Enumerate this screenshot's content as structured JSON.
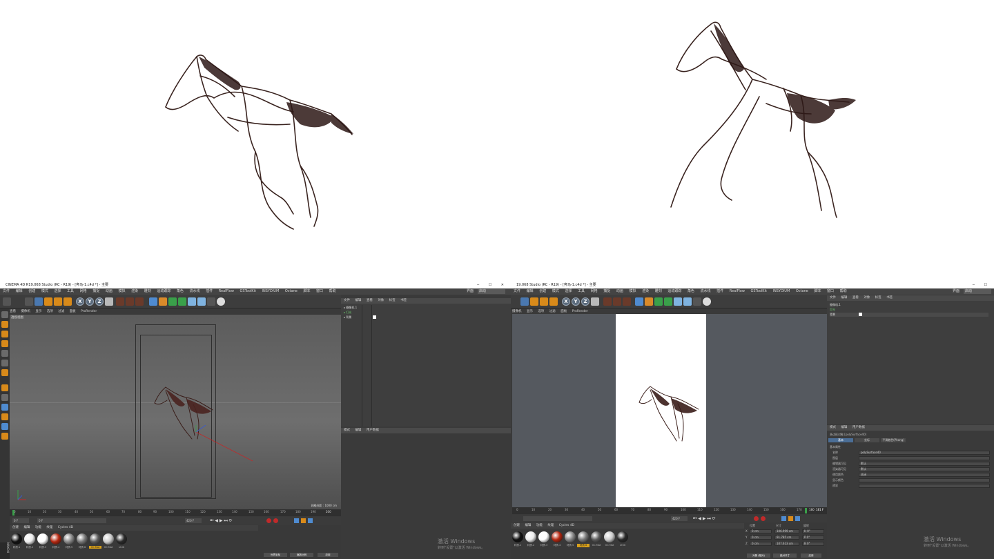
{
  "top_preview": {
    "left_horse": "horse-line-render",
    "right_horse": "horse-line-render"
  },
  "left_window": {
    "title": "CINEMA 4D R19.068 Studio (RC - R19) - [奔马-1.c4d *] - 主要",
    "menu": [
      "文件",
      "编辑",
      "创建",
      "模式",
      "选择",
      "工具",
      "网格",
      "捕捉",
      "动画",
      "模拟",
      "渲染",
      "雕刻",
      "运动跟踪",
      "运动图形",
      "角色",
      "流水线",
      "插件",
      "RealFlow",
      "X-Particles",
      "Octane",
      "脚本",
      "窗口",
      "帮助"
    ],
    "menu_short": [
      "文件",
      "编辑",
      "创建",
      "模式",
      "选择",
      "工具",
      "网格",
      "捕捉",
      "动画",
      "模拟",
      "渲染",
      "雕刻",
      "运动跟踪",
      "角色",
      "流水线",
      "插件",
      "RealFlow",
      "GSToolKit",
      "INSYDIUM",
      "Octane",
      "脚本",
      "窗口",
      "帮助"
    ],
    "layout_label": "界面",
    "layout_value": "启动",
    "viewport_menu": [
      "查看",
      "摄像机",
      "显示",
      "选项",
      "过滤",
      "面板",
      "ProRender"
    ],
    "viewport_label": "透视视图",
    "grid_label": "网格间距 : 1000 cm",
    "objects_menu": [
      "文件",
      "编辑",
      "查看",
      "对象",
      "标签",
      "书签"
    ],
    "objects": [
      {
        "name": "摄像机.1",
        "icon": "camera-icon"
      },
      {
        "name": "灯光",
        "icon": "light-icon"
      },
      {
        "name": "背景",
        "icon": "background-icon"
      }
    ],
    "attr_menu": [
      "模式",
      "编辑",
      "用户数据"
    ],
    "timeline_ticks": [
      "0",
      "10",
      "20",
      "30",
      "40",
      "50",
      "60",
      "70",
      "80",
      "90",
      "100",
      "110",
      "120",
      "130",
      "140",
      "150",
      "160",
      "170",
      "180",
      "190",
      "200"
    ],
    "frame_start": "0 F",
    "frame_current": "0 F",
    "frame_end": "420 F",
    "frame_end2": "420 F",
    "material_menu": [
      "创建",
      "编辑",
      "功能",
      "纹理",
      "Cycles 4D"
    ],
    "materials": [
      {
        "label": "材质.1",
        "color": "#111111"
      },
      {
        "label": "材质.2",
        "color": "#eeeeee"
      },
      {
        "label": "材质.3",
        "color": "#ffffff"
      },
      {
        "label": "材质.4",
        "color": "#b4260f"
      },
      {
        "label": "材质.5",
        "color": "#888888"
      },
      {
        "label": "材质.6",
        "color": "#777777"
      },
      {
        "label": "OC Mat",
        "color": "#5a5a5a"
      },
      {
        "label": "OC Mat",
        "color": "#cccccc"
      },
      {
        "label": "Unlit",
        "color": "#2a2a2a"
      }
    ],
    "coord_buttons": [
      "世界坐标",
      "缩放比例",
      "应用"
    ],
    "watermark_title": "激活 Windows",
    "watermark_sub": "转到\"设置\"以激活 Windows。"
  },
  "right_window": {
    "title": "19.068 Studio (RC - R19) - [奔马-1.c4d *] - 主要",
    "viewport_menu": [
      "摄像机",
      "显示",
      "选项",
      "过滤",
      "面板",
      "ProRender"
    ],
    "objects_menu": [
      "文件",
      "编辑",
      "查看",
      "对象",
      "标签",
      "书签"
    ],
    "objects": [
      {
        "name": "摄像机.1",
        "icon": "camera-icon"
      },
      {
        "name": "灯光",
        "icon": "light-icon"
      },
      {
        "name": "背景",
        "icon": "background-icon"
      }
    ],
    "attr_menu": [
      "模式",
      "编辑",
      "用户数据"
    ],
    "attr_object": "多边形对象 [polySurface40]",
    "attr_tabs": [
      "基本",
      "坐标",
      "平滑着色(Phong)"
    ],
    "attr_section": "基本属性",
    "attr_fields": [
      {
        "label": "名称",
        "value": "polySurface40"
      },
      {
        "label": "图层",
        "value": ""
      },
      {
        "label": "编辑器可见",
        "value": "默认"
      },
      {
        "label": "渲染器可见",
        "value": "默认"
      },
      {
        "label": "使用颜色",
        "value": "关闭"
      },
      {
        "label": "显示颜色",
        "value": ""
      },
      {
        "label": "透显",
        "value": ""
      }
    ],
    "timeline_ticks": [
      "0",
      "10",
      "20",
      "30",
      "40",
      "50",
      "60",
      "70",
      "80",
      "90",
      "100",
      "110",
      "120",
      "130",
      "140",
      "150",
      "160",
      "170",
      "180"
    ],
    "frame_current": "181 F",
    "frame_end": "420 F",
    "coord_headers": [
      "位置",
      "尺寸",
      "旋转"
    ],
    "coord_rows": [
      {
        "axis": "X",
        "pos": "0 cm",
        "size": "106.999 cm",
        "rot": "H 0°"
      },
      {
        "axis": "Y",
        "pos": "0 cm",
        "size": "91.785 cm",
        "rot": "P 0°"
      },
      {
        "axis": "Z",
        "pos": "0 cm",
        "size": "107.613 cm",
        "rot": "B 0°"
      }
    ],
    "coord_buttons": [
      "对象 (相对)",
      "绝对尺寸",
      "应用"
    ],
    "watermark_title": "激活 Windows",
    "watermark_sub": "转到\"设置\"以激活 Windows。"
  }
}
